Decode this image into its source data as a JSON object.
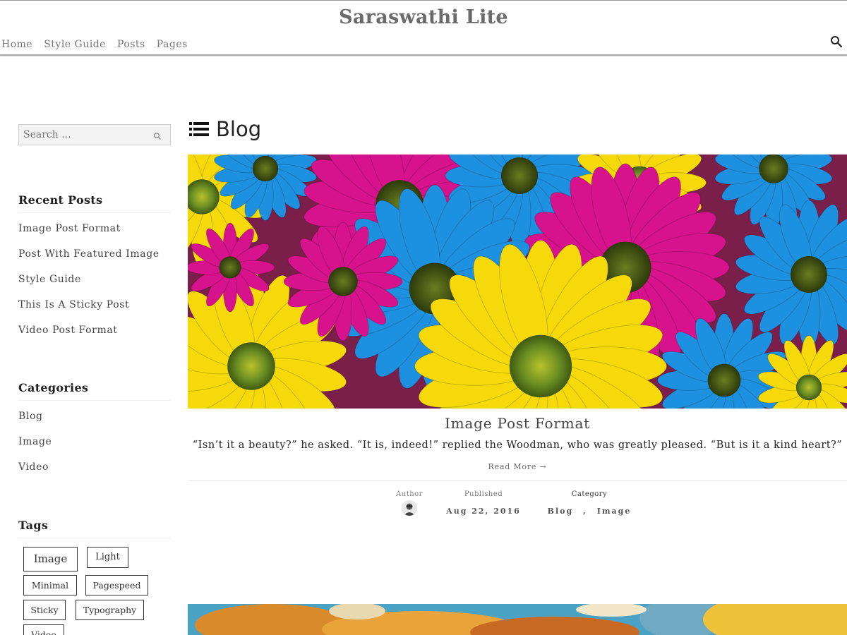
{
  "site": {
    "title": "Saraswathi Lite"
  },
  "nav": {
    "items": [
      {
        "label": "Home"
      },
      {
        "label": "Style Guide"
      },
      {
        "label": "Posts"
      },
      {
        "label": "Pages"
      }
    ],
    "search_icon": "search-icon"
  },
  "sidebar": {
    "search": {
      "placeholder": "Search ..."
    },
    "recent_posts": {
      "title": "Recent Posts",
      "items": [
        "Image Post Format",
        "Post With Featured Image",
        "Style Guide",
        "This Is A Sticky Post",
        "Video Post Format"
      ]
    },
    "categories": {
      "title": "Categories",
      "items": [
        "Blog",
        "Image",
        "Video"
      ]
    },
    "tags": {
      "title": "Tags",
      "items": [
        "Image",
        "Light",
        "Minimal",
        "Pagespeed",
        "Sticky",
        "Typography",
        "Video"
      ]
    }
  },
  "main": {
    "heading": "Blog",
    "heading_icon": "list-icon",
    "post": {
      "title": "Image Post Format",
      "excerpt": "“Isn’t it a beauty?” he asked. “It is, indeed!” replied the Woodman, who was greatly pleased. “But is it a kind heart?”",
      "read_more": "Read More →",
      "meta": {
        "author_label": "Author",
        "published_label": "Published",
        "published_value": "Aug 22, 2016",
        "category_label": "Category",
        "categories": [
          "Blog",
          "Image"
        ],
        "category_separator": ","
      }
    }
  },
  "colors": {
    "title_gray": "#6b6b6b",
    "magenta": "#d6138c",
    "blue": "#1e90e0",
    "yellow": "#f5d90a",
    "green_center": "#6b8e23"
  }
}
